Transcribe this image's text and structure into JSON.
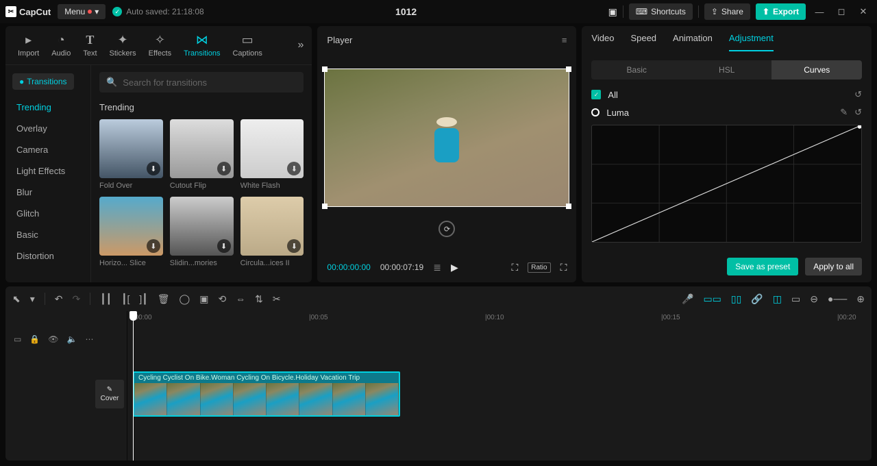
{
  "app": {
    "name": "CapCut"
  },
  "titlebar": {
    "menu": "Menu",
    "autosave": "Auto saved: 21:18:08",
    "project": "1012",
    "shortcuts": "Shortcuts",
    "share": "Share",
    "export": "Export"
  },
  "media_tabs": [
    {
      "key": "import",
      "label": "Import"
    },
    {
      "key": "audio",
      "label": "Audio"
    },
    {
      "key": "text",
      "label": "Text"
    },
    {
      "key": "stickers",
      "label": "Stickers"
    },
    {
      "key": "effects",
      "label": "Effects"
    },
    {
      "key": "transitions",
      "label": "Transitions",
      "active": true
    },
    {
      "key": "captions",
      "label": "Captions"
    }
  ],
  "left": {
    "pill": "Transitions",
    "categories": [
      "Trending",
      "Overlay",
      "Camera",
      "Light Effects",
      "Blur",
      "Glitch",
      "Basic",
      "Distortion"
    ],
    "active_category": "Trending",
    "search_placeholder": "Search for transitions",
    "section_heading": "Trending",
    "items": [
      {
        "label": "Fold Over"
      },
      {
        "label": "Cutout Flip"
      },
      {
        "label": "White Flash"
      },
      {
        "label": "Horizo... Slice"
      },
      {
        "label": "Slidin...mories"
      },
      {
        "label": "Circula...ices II"
      }
    ]
  },
  "player": {
    "title": "Player",
    "current": "00:00:00:00",
    "duration": "00:00:07:19",
    "ratio_label": "Ratio"
  },
  "right": {
    "tabs": [
      "Video",
      "Speed",
      "Animation",
      "Adjustment"
    ],
    "active_tab": "Adjustment",
    "subtabs": [
      "Basic",
      "HSL",
      "Curves"
    ],
    "active_subtab": "Curves",
    "all_label": "All",
    "luma_label": "Luma",
    "save_preset": "Save as preset",
    "apply_all": "Apply to all"
  },
  "timeline": {
    "marks": [
      "|00:00",
      "|00:05",
      "|00:10",
      "|00:15",
      "|00:20"
    ],
    "clip_title": "Cycling Cyclist On Bike.Woman Cycling On Bicycle.Holiday Vacation Trip",
    "cover": "Cover"
  }
}
